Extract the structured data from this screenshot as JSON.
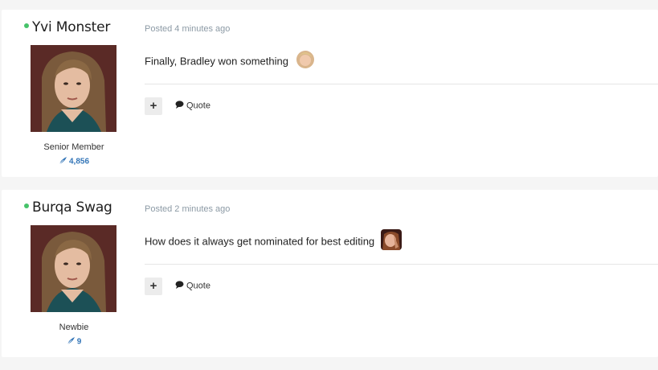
{
  "posts": [
    {
      "author": "Yvi Monster",
      "online": true,
      "rank": "Senior Member",
      "reputation": "4,856",
      "date": "Posted 4 minutes ago",
      "text": "Finally, Bradley won something",
      "quote_label": "Quote",
      "react_label": "+"
    },
    {
      "author": "Burqa Swag",
      "online": true,
      "rank": "Newbie",
      "reputation": "9",
      "date": "Posted 2 minutes ago",
      "text": "How does it always get nominated for best editing",
      "quote_label": "Quote",
      "react_label": "+"
    }
  ],
  "colors": {
    "online": "#46c36a",
    "reputation": "#3476b8",
    "meta": "#8c9aa5",
    "background": "#f5f5f5"
  },
  "icons": {
    "online": "online-dot",
    "reputation": "feather-icon",
    "quote": "speech-bubble-icon",
    "react": "plus-icon"
  }
}
